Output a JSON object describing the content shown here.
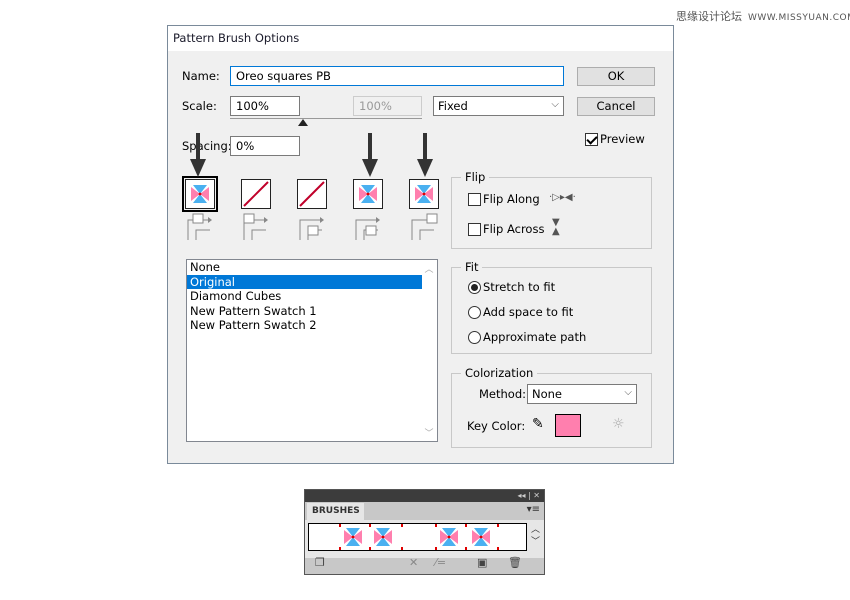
{
  "watermark": {
    "cn": "思缘设计论坛",
    "url": "WWW.MISSYUAN.COM"
  },
  "dialog": {
    "title": "Pattern Brush Options",
    "name_label": "Name:",
    "name_value": "Oreo squares PB",
    "ok": "OK",
    "cancel": "Cancel",
    "scale_label": "Scale:",
    "scale_value": "100%",
    "scale_max": "100%",
    "scale_mode": "Fixed",
    "spacing_label": "Spacing:",
    "spacing_value": "0%",
    "preview_label": "Preview",
    "preview_checked": true,
    "tiles": [
      "Side Tile",
      "Outer Corner Tile",
      "Inner Corner Tile",
      "Start Tile",
      "End Tile"
    ],
    "list": [
      "None",
      "Original",
      "Diamond Cubes",
      "New Pattern Swatch 1",
      "New Pattern Swatch 2"
    ],
    "list_selected": "Original",
    "flip": {
      "title": "Flip",
      "along": "Flip Along",
      "across": "Flip Across"
    },
    "fit": {
      "title": "Fit",
      "options": [
        "Stretch to fit",
        "Add space to fit",
        "Approximate path"
      ],
      "selected": "Stretch to fit"
    },
    "colorization": {
      "title": "Colorization",
      "method_label": "Method:",
      "method_value": "None",
      "key_label": "Key Color:",
      "key_color": "#ff7fae"
    }
  },
  "colors": {
    "pink": "#ff7fae",
    "blue": "#4ab0f0",
    "red": "#e00000",
    "select": "#0078d7"
  },
  "panel": {
    "tab": "BRUSHES"
  }
}
